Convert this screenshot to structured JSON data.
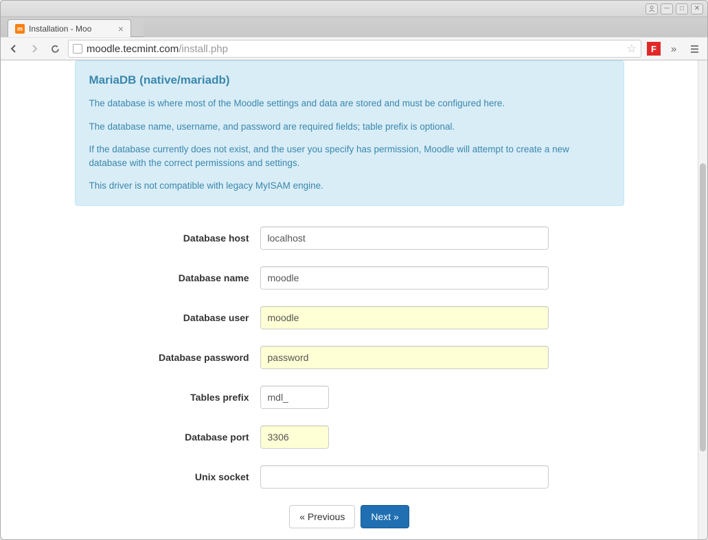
{
  "browser": {
    "tab_title": "Installation - Moo",
    "url_domain": "moodle.tecmint.com",
    "url_path": "/install.php"
  },
  "alert": {
    "title": "MariaDB (native/mariadb)",
    "p1": "The database is where most of the Moodle settings and data are stored and must be configured here.",
    "p2": "The database name, username, and password are required fields; table prefix is optional.",
    "p3": "If the database currently does not exist, and the user you specify has permission, Moodle will attempt to create a new database with the correct permissions and settings.",
    "p4": "This driver is not compatible with legacy MyISAM engine."
  },
  "form": {
    "db_host": {
      "label": "Database host",
      "value": "localhost"
    },
    "db_name": {
      "label": "Database name",
      "value": "moodle"
    },
    "db_user": {
      "label": "Database user",
      "value": "moodle"
    },
    "db_pass": {
      "label": "Database password",
      "value": "password"
    },
    "prefix": {
      "label": "Tables prefix",
      "value": "mdl_"
    },
    "db_port": {
      "label": "Database port",
      "value": "3306"
    },
    "socket": {
      "label": "Unix socket",
      "value": ""
    }
  },
  "buttons": {
    "prev": "« Previous",
    "next": "Next »"
  }
}
